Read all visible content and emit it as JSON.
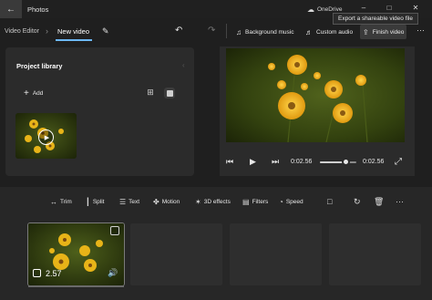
{
  "titlebar": {
    "back_icon": "back-arrow-icon",
    "app_title": "Photos",
    "cloud_label": "OneDrive",
    "minimize_glyph": "–",
    "maximize_glyph": "□",
    "close_glyph": "✕",
    "tooltip": "Export a shareable video file"
  },
  "toolbar": {
    "breadcrumb_root": "Video Editor",
    "breadcrumb_sep": "›",
    "project_name": "New video",
    "background_music_label": "Background music",
    "custom_audio_label": "Custom audio",
    "finish_video_label": "Finish video",
    "more_glyph": "···",
    "accent_color": "#6cb8f6"
  },
  "library": {
    "title": "Project library",
    "add_label": "Add",
    "collapse_glyph": "‹"
  },
  "player": {
    "current_time": "0:02.56",
    "total_time": "0:02.56",
    "seek_fraction": 0.7
  },
  "storyboard": {
    "tools": [
      {
        "name": "trim",
        "icon": "trim-icon",
        "glyph": "↔",
        "label": "Trim"
      },
      {
        "name": "split",
        "icon": "split-icon",
        "glyph": "┃",
        "label": "Split"
      },
      {
        "name": "text",
        "icon": "text-icon",
        "glyph": "☰",
        "label": "Text"
      },
      {
        "name": "motion",
        "icon": "motion-icon",
        "glyph": "✤",
        "label": "Motion"
      },
      {
        "name": "3d-effects",
        "icon": "3d-effects-icon",
        "glyph": "✶",
        "label": "3D effects"
      },
      {
        "name": "filters",
        "icon": "filters-icon",
        "glyph": "▤",
        "label": "Filters"
      },
      {
        "name": "speed",
        "icon": "speed-icon",
        "glyph": "◔",
        "label": "Speed"
      }
    ],
    "more_glyph": "···",
    "clip_duration": "2.57"
  }
}
